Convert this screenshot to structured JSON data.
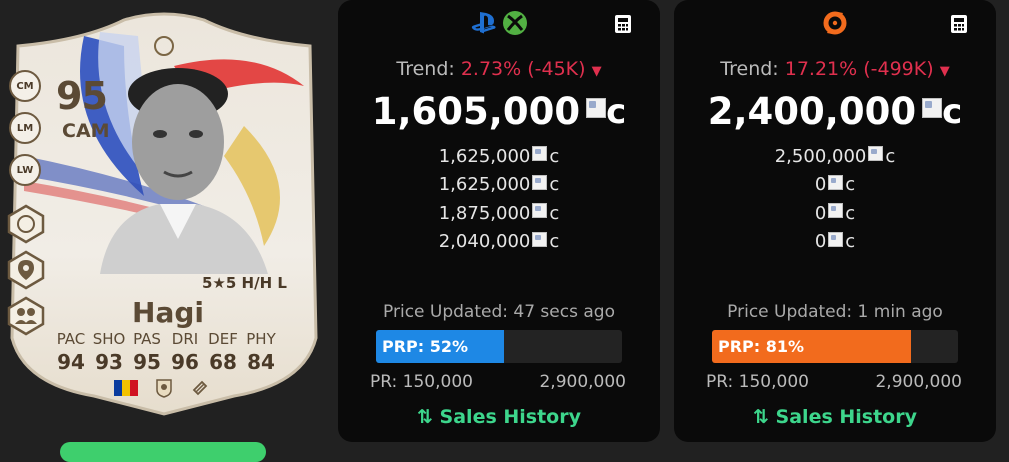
{
  "card": {
    "rating": "95",
    "position": "CAM",
    "alt_positions": [
      "CM",
      "LM",
      "LW"
    ],
    "skills_weakfoot_workrates": "5★5 H/H L",
    "name": "Hagi",
    "stat_labels": [
      "PAC",
      "SHO",
      "PAS",
      "DRI",
      "DEF",
      "PHY"
    ],
    "stat_values": [
      "94",
      "93",
      "95",
      "96",
      "68",
      "84"
    ],
    "nation_flag_colors": [
      "#0b3c9e",
      "#f2c200",
      "#d01222"
    ]
  },
  "panels": [
    {
      "platform_icons": [
        "playstation-icon",
        "xbox-icon"
      ],
      "trend_label": "Trend:",
      "trend_change": "2.73% (-45K)",
      "price": "1,605,000",
      "coin_suffix": "c",
      "alt_prices": [
        "1,625,000",
        "1,625,000",
        "1,875,000",
        "2,040,000"
      ],
      "updated": "Price Updated: 47 secs ago",
      "prp_label": "PRP: 52%",
      "prp_percent": 52,
      "bar_color": "#1e88e5",
      "range_min": "PR: 150,000",
      "range_max": "2,900,000",
      "sales_history": "Sales History"
    },
    {
      "platform_icons": [
        "origin-icon"
      ],
      "trend_label": "Trend:",
      "trend_change": "17.21% (-499K)",
      "price": "2,400,000",
      "coin_suffix": "c",
      "alt_prices": [
        "2,500,000",
        "0",
        "0",
        "0"
      ],
      "updated": "Price Updated: 1 min ago",
      "prp_label": "PRP: 81%",
      "prp_percent": 81,
      "bar_color": "#f26b1d",
      "range_min": "PR: 150,000",
      "range_max": "2,900,000",
      "sales_history": "Sales History"
    }
  ],
  "colors": {
    "trend_down": "#e0304e",
    "sales_history": "#3dd68c",
    "panel_bg": "#0a0a0a",
    "page_bg": "#212121"
  }
}
